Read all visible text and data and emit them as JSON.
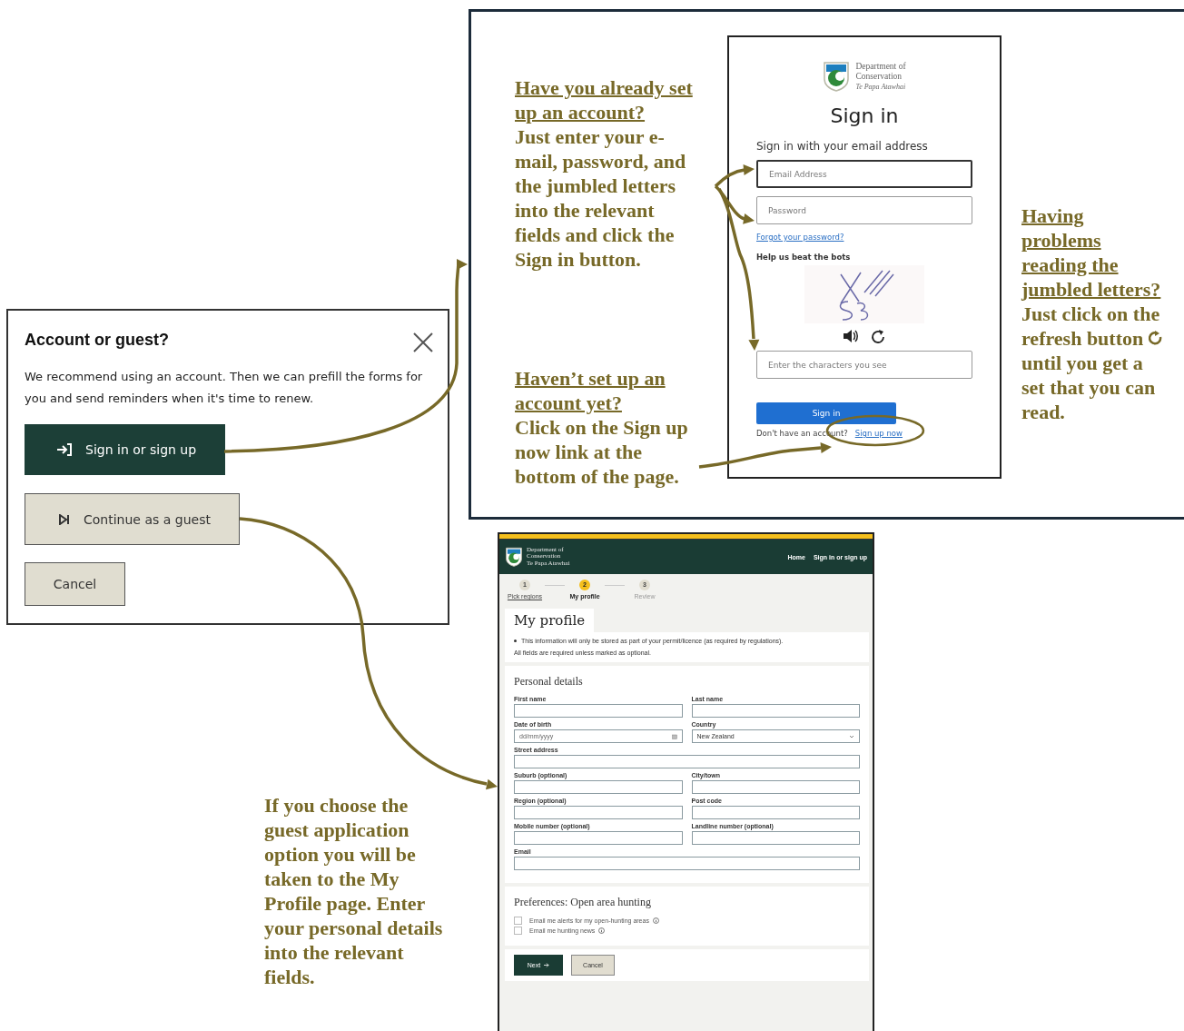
{
  "account_dialog": {
    "title": "Account or guest?",
    "message": "We recommend using an account. Then we can prefill the forms for you and send reminders when it's time to renew.",
    "buttons": [
      {
        "label": "Sign in or sign up",
        "kind": "primary"
      },
      {
        "label": "Continue as a guest",
        "kind": "secondary"
      },
      {
        "label": "Cancel",
        "kind": "plain"
      }
    ]
  },
  "sign_in_callout": {
    "heading": "Have you already set up an account?",
    "body": "Just enter your e-mail, password, and the jumbled letters into the relevant fields and click the Sign in button."
  },
  "sign_up_callout": {
    "heading": "Haven’t set up an account yet?",
    "body": "Click on the Sign up now link at the bottom of the page."
  },
  "sign_in_page": {
    "logo": [
      "Department of",
      "Conservation",
      "Te Papa Atawhai"
    ],
    "title": "Sign in",
    "subtitle": "Sign in with your email address",
    "fields": [
      {
        "placeholder": "Email Address",
        "focused": true
      },
      {
        "placeholder": "Password",
        "focused": false
      }
    ],
    "forgot_link": "Forgot your password?",
    "captcha_label": "Help us beat the bots",
    "captcha_placeholder": "Enter the characters you see",
    "button": "Sign in",
    "prompt": "Don't have an account?",
    "signup_link": "Sign up now"
  },
  "captcha_callout": {
    "heading": "Having problems reading the jumbled letters?",
    "body_start": "Just click on the refresh button",
    "body_end": "until you get a set that you can read."
  },
  "guest_callout": {
    "body": "If you choose the guest application option you will be taken to the My Profile page. Enter your personal details into the relevant fields."
  },
  "profile_page": {
    "logo": [
      "Department of",
      "Conservation",
      "Te Papa Atawhai"
    ],
    "nav": [
      "Home",
      "Sign in or sign up"
    ],
    "steps": [
      {
        "number": "1",
        "label": "Pick regions",
        "completed": true,
        "selected": false
      },
      {
        "number": "2",
        "label": "My profile",
        "completed": false,
        "selected": true
      },
      {
        "number": "3",
        "label": "Review",
        "completed": false,
        "selected": false
      }
    ],
    "title": "My profile",
    "notice": "This information will only be stored as part of your permit/licence (as required by regulations).",
    "required_note": "All fields are required unless marked as optional.",
    "details_heading": "Personal details",
    "field_rows": [
      [
        {
          "label": "First name",
          "kind": "text"
        },
        {
          "label": "Last name",
          "kind": "text"
        }
      ],
      [
        {
          "label": "Date of birth",
          "kind": "date",
          "placeholder": "dd/mm/yyyy"
        },
        {
          "label": "Country",
          "kind": "select",
          "value": "New Zealand"
        }
      ],
      [
        {
          "label": "Street address",
          "kind": "text"
        }
      ],
      [
        {
          "label": "Suburb (optional)",
          "kind": "text"
        },
        {
          "label": "City/town",
          "kind": "text"
        }
      ],
      [
        {
          "label": "Region (optional)",
          "kind": "text"
        },
        {
          "label": "Post code",
          "kind": "text"
        }
      ],
      [
        {
          "label": "Mobile number (optional)",
          "kind": "text"
        },
        {
          "label": "Landline number (optional)",
          "kind": "text"
        }
      ],
      [
        {
          "label": "Email",
          "kind": "text"
        }
      ]
    ],
    "preferences_heading": "Preferences: Open area hunting",
    "preferences": [
      {
        "label": "Email me alerts for my open-hunting areas",
        "checked": false
      },
      {
        "label": "Email me hunting news",
        "checked": false
      }
    ],
    "next_button": "Next",
    "cancel_button": "Cancel"
  }
}
